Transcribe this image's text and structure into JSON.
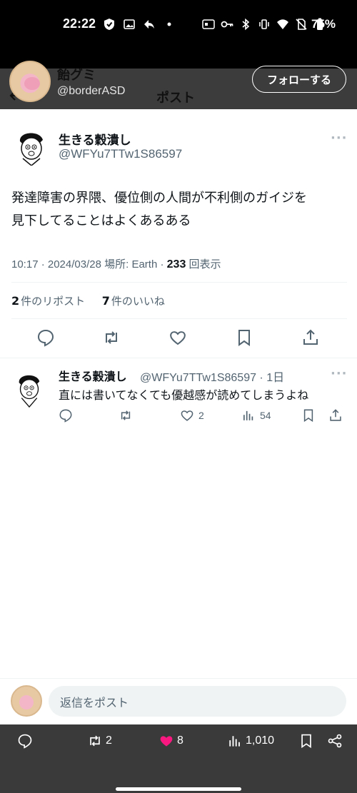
{
  "status_bar": {
    "time": "22:22",
    "battery": "75%"
  },
  "header": {
    "display_name": "飴グミ",
    "handle": "@borderASD",
    "title": "ポスト",
    "follow_label": "フォローする",
    "bg_color": "#3c3c3c"
  },
  "tweet": {
    "author_name": "生きる穀潰し",
    "author_handle": "@WFYu7TTw1S86597",
    "text_line1": "発達障害の界隈、優位側の人間が不利側のガイジを",
    "text_line2": "見下してることはよくあるある",
    "time_date": "10:17 · 2024/03/28",
    "location": "場所: Earth",
    "views_count": "233",
    "views_label": "回表示",
    "reposts_count": "2",
    "reposts_label": "件のリポスト",
    "likes_count": "7",
    "likes_label": "件のいいね"
  },
  "reply": {
    "author_name": "生きる穀潰し",
    "author_handle": "@WFYu7TTw1S86597 · 1日",
    "text": "直には書いてなくても優越感が読めてしまうよね",
    "likes": "2",
    "views": "54"
  },
  "composer": {
    "placeholder": "返信をポスト"
  },
  "bottom_bar": {
    "reposts": "2",
    "likes": "8",
    "views": "1,010",
    "like_color": "#f91880"
  },
  "icons": [
    "back-arrow-icon",
    "reply-icon",
    "repost-icon",
    "like-icon",
    "bookmark-icon",
    "share-icon",
    "views-icon",
    "more-icon",
    "home-icon",
    "search-icon",
    "notifications-icon",
    "messages-icon"
  ]
}
